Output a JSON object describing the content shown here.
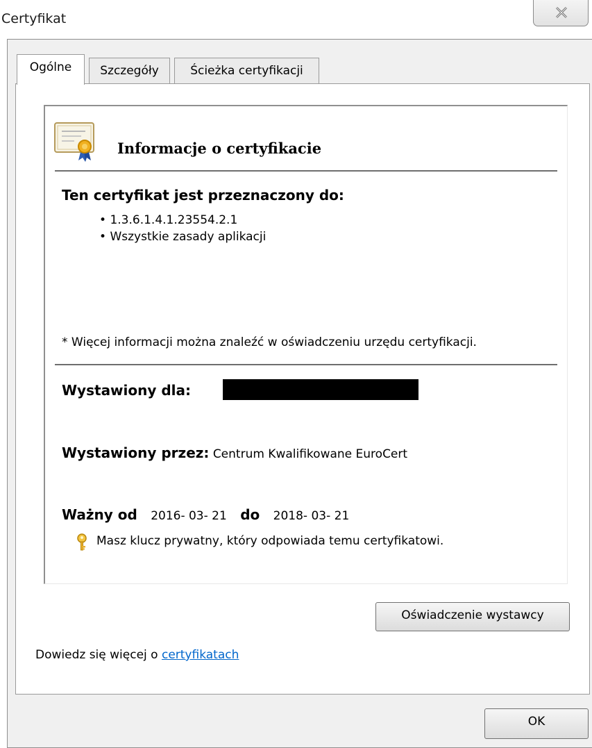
{
  "window": {
    "title": "Certyfikat"
  },
  "tabs": [
    {
      "label": "Ogólne",
      "active": true
    },
    {
      "label": "Szczegóły",
      "active": false
    },
    {
      "label": "Ścieżka certyfikacji",
      "active": false
    }
  ],
  "info": {
    "title": "Informacje o certyfikacie",
    "purpose_heading": "Ten certyfikat jest przeznaczony do:",
    "purposes": [
      "1.3.6.1.4.1.23554.2.1",
      "Wszystkie zasady aplikacji"
    ],
    "note": "* Więcej informacji można znaleźć w oświadczeniu urzędu certyfikacji.",
    "issued_to_label": "Wystawiony dla:",
    "issued_by_label": "Wystawiony przez:",
    "issued_by_value": "Centrum Kwalifikowane EuroCert",
    "valid_from_label": "Ważny od",
    "valid_from": "2016- 03- 21",
    "valid_to_label": "do",
    "valid_to": "2018- 03- 21",
    "private_key_note": "Masz klucz prywatny, który odpowiada temu certyfikatowi."
  },
  "buttons": {
    "issuer_statement": "Oświadczenie wystawcy",
    "ok": "OK"
  },
  "learn_more": {
    "prefix": "Dowiedz się więcej o ",
    "link": "certyfikatach"
  },
  "colors": {
    "link": "#0066cc",
    "redaction": "#000000"
  }
}
